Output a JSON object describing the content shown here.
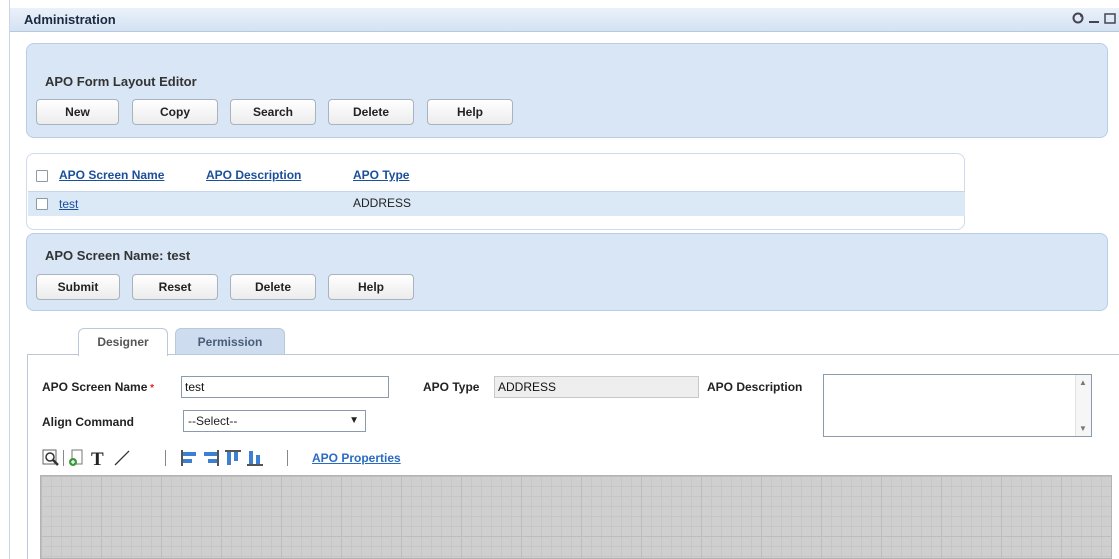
{
  "window": {
    "title": "Administration",
    "controls": [
      "refresh-icon",
      "minimize-icon",
      "maximize-icon"
    ]
  },
  "editor_panel": {
    "title": "APO Form Layout Editor",
    "buttons": [
      "New",
      "Copy",
      "Search",
      "Delete",
      "Help"
    ]
  },
  "results_table": {
    "columns": [
      "APO Screen Name",
      "APO Description",
      "APO Type"
    ],
    "rows": [
      {
        "screen_name": "test",
        "description": "",
        "type": "ADDRESS"
      }
    ]
  },
  "screen_panel": {
    "title": "APO Screen Name: test",
    "buttons": [
      "Submit",
      "Reset",
      "Delete",
      "Help"
    ]
  },
  "tabs": [
    {
      "label": "Designer",
      "active": true
    },
    {
      "label": "Permission",
      "active": false
    }
  ],
  "form": {
    "screen_name_label": "APO Screen Name",
    "screen_name_value": "test",
    "type_label": "APO Type",
    "type_value": "ADDRESS",
    "description_label": "APO Description",
    "description_value": "",
    "align_label": "Align Command",
    "align_value": "--Select--"
  },
  "toolbar": {
    "icons": [
      "zoom-icon",
      "add-field-icon",
      "text-icon",
      "line-icon",
      "align-left-icon",
      "align-right-icon",
      "align-top-icon",
      "align-bottom-icon"
    ],
    "properties_link": "APO Properties"
  },
  "colors": {
    "panel_bg": "#d9e6f5",
    "link": "#1b4f9a",
    "row_bg": "#dbe9f6",
    "canvas_bg": "#cfcfcf"
  }
}
